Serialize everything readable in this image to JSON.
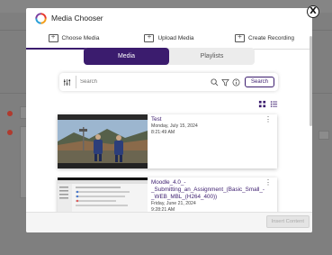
{
  "modal": {
    "title": "Media Chooser",
    "close_label": "X"
  },
  "tabs": [
    {
      "label": "Choose Media",
      "icon": "upload-box-icon",
      "active": true
    },
    {
      "label": "Upload Media",
      "icon": "upload-box-icon",
      "active": false
    },
    {
      "label": "Create Recording",
      "icon": "add-box-icon",
      "active": false
    }
  ],
  "segment": {
    "media_label": "Media",
    "playlists_label": "Playlists"
  },
  "search": {
    "placeholder": "Search",
    "button_label": "Search"
  },
  "media_items": [
    {
      "title": "Test",
      "date": "Monday, July 15, 2024",
      "time": "8:21:49 AM"
    },
    {
      "title": "Moodle_4.0_-_Submitting_an_Assignment_(Basic_Small_-_WEB_MBL_(H264_400))",
      "date": "Friday, June 21, 2024",
      "time": "9:28:21 AM"
    }
  ],
  "footer": {
    "insert_label": "Insert Content"
  },
  "colors": {
    "accent": "#3b1c6e"
  }
}
